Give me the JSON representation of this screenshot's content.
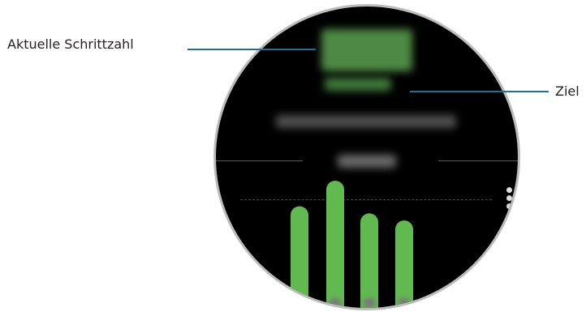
{
  "labels": {
    "steps": "Aktuelle Schrittzahl",
    "goal": "Ziel"
  },
  "colors": {
    "accent_green": "#61ba4f",
    "leader_line": "#1f6f97",
    "watch_bezel": "#bcbcbc",
    "watch_face": "#000000"
  },
  "chart_data": {
    "type": "bar",
    "values": [
      0.62,
      0.8,
      0.57,
      0.52
    ],
    "ylim": [
      0,
      1
    ],
    "color": "#61ba4f"
  }
}
